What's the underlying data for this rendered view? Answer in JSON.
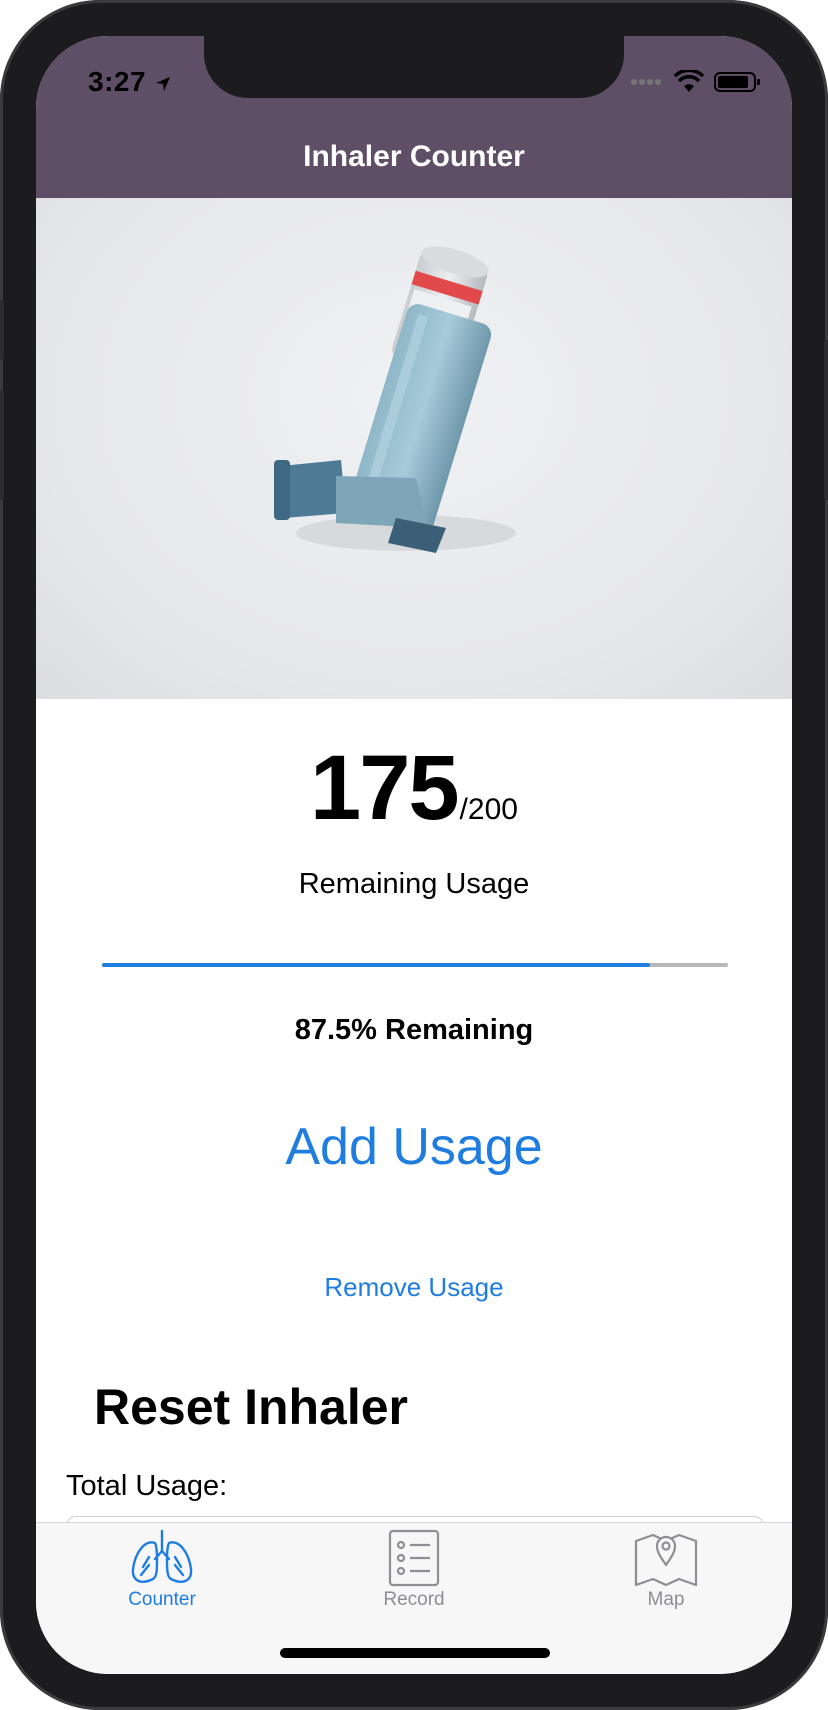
{
  "status": {
    "time": "3:27"
  },
  "nav": {
    "title": "Inhaler Counter"
  },
  "counter": {
    "remaining": "175",
    "total": "/200",
    "remaining_label": "Remaining Usage",
    "percent_label": "87.5% Remaining",
    "progress_fraction": 0.875
  },
  "actions": {
    "add_label": "Add Usage",
    "remove_label": "Remove Usage"
  },
  "reset": {
    "title": "Reset Inhaler",
    "total_usage_label": "Total Usage:"
  },
  "tabs": [
    {
      "label": "Counter",
      "icon": "lungs-icon",
      "active": true
    },
    {
      "label": "Record",
      "icon": "clipboard-list-icon",
      "active": false
    },
    {
      "label": "Map",
      "icon": "map-pin-icon",
      "active": false
    }
  ],
  "colors": {
    "header": "#5f4f66",
    "accent": "#1f7de0",
    "inactive": "#8e8e93"
  }
}
